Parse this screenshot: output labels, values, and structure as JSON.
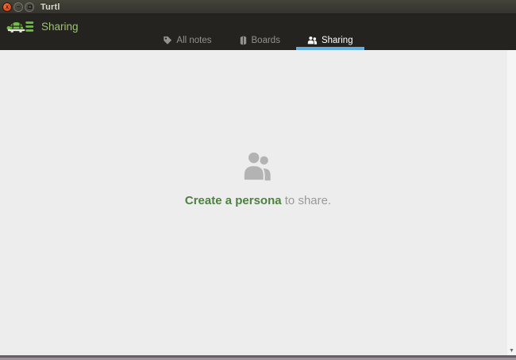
{
  "titlebar": {
    "title": "Turtl",
    "close_glyph": "x",
    "minimize_glyph": "–"
  },
  "header": {
    "page_title": "Sharing"
  },
  "tabs": [
    {
      "label": "All notes",
      "icon": "tag-icon",
      "active": false
    },
    {
      "label": "Boards",
      "icon": "board-icon",
      "active": false
    },
    {
      "label": "Sharing",
      "icon": "people-icon",
      "active": true
    }
  ],
  "empty_state": {
    "icon": "personas-icon",
    "link_text": "Create a persona",
    "suffix_text": " to share."
  },
  "scrollbar": {
    "down_arrow_glyph": "▼"
  },
  "colors": {
    "header_green": "#9cc46e",
    "link_green": "#4e8040",
    "tab_underline_blue": "#62aede",
    "close_button_orange": "#dd4814",
    "logo_green": "#6fbf44",
    "empty_icon_gray": "#b3b3b3",
    "content_background": "#ededed",
    "header_background": "#24231f"
  }
}
